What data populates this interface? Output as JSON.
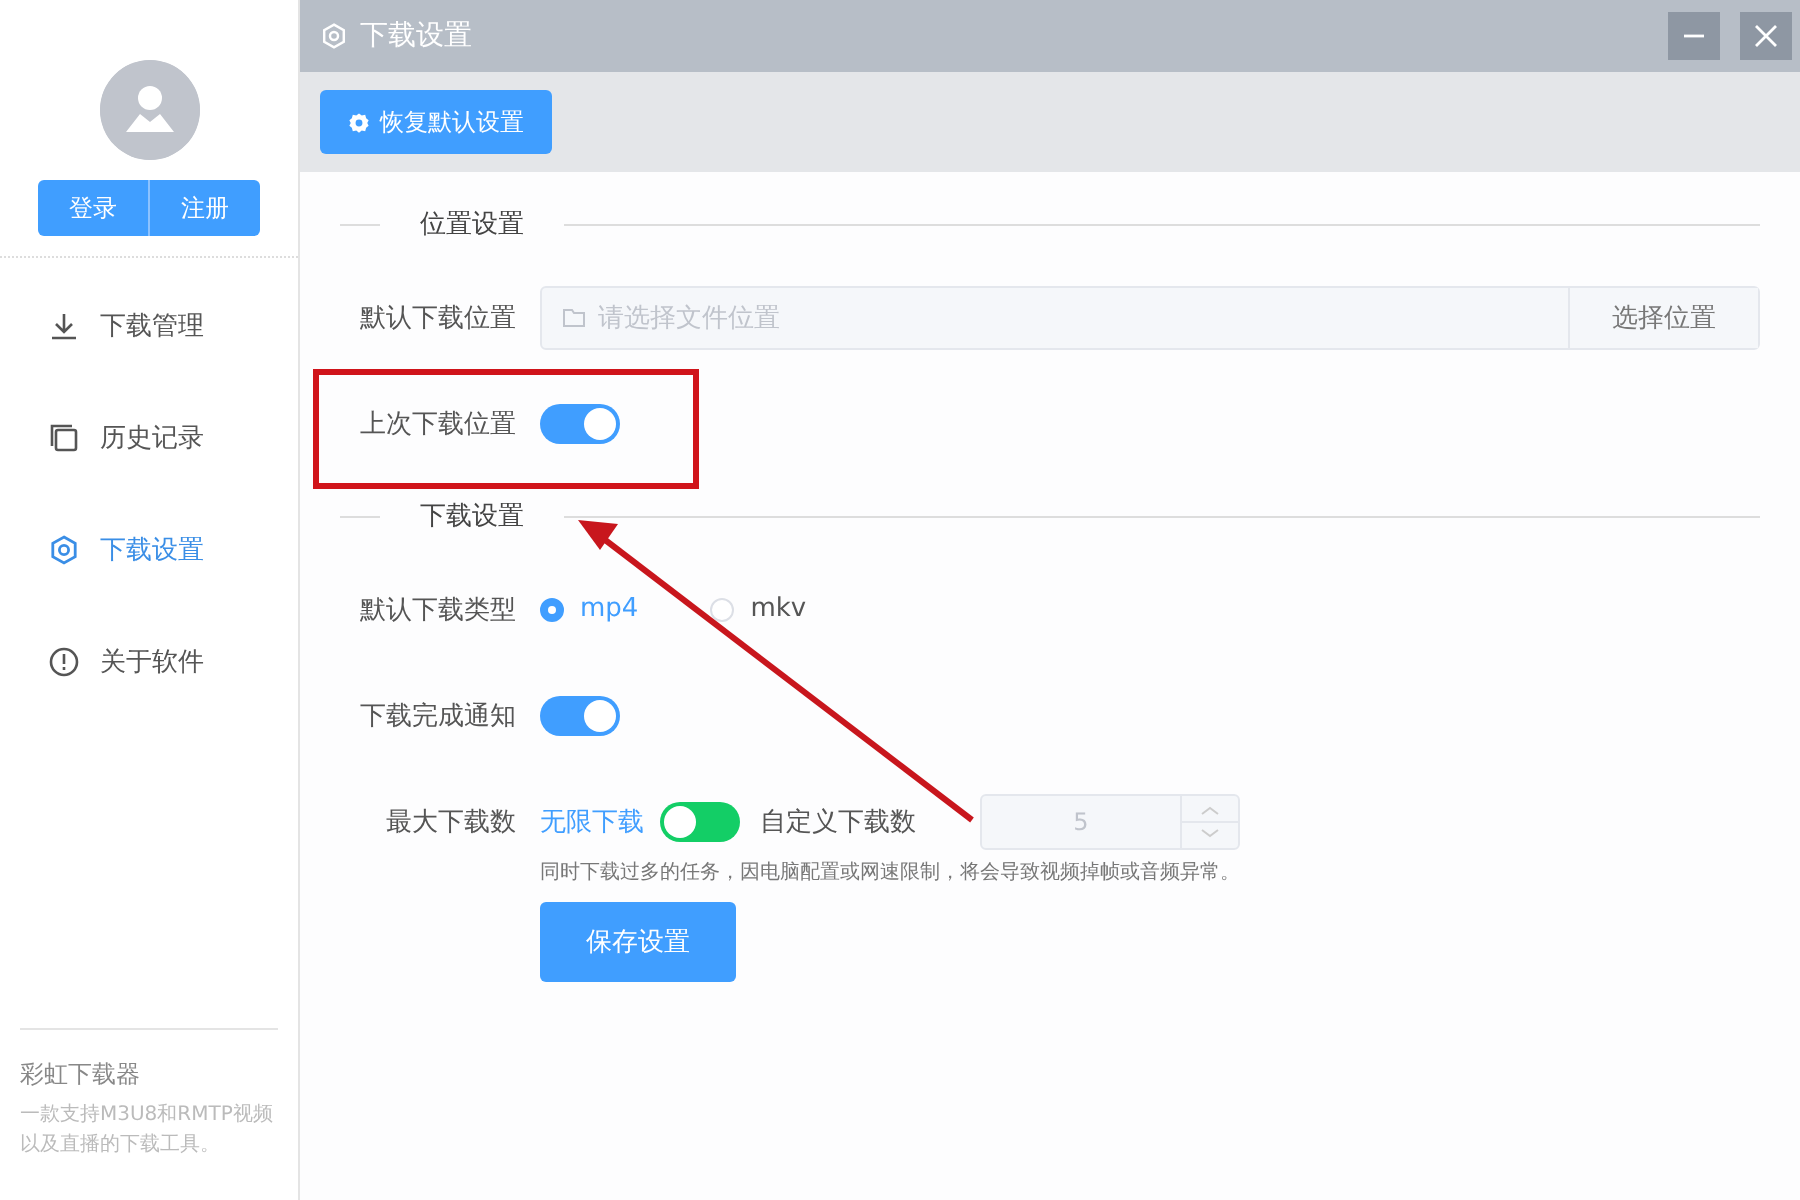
{
  "sidebar": {
    "login_button": "登录",
    "register_button": "注册",
    "items": [
      {
        "kind": "download",
        "label": "下载管理",
        "selected": false
      },
      {
        "kind": "history",
        "label": "历史记录",
        "selected": false
      },
      {
        "kind": "settings",
        "label": "下载设置",
        "selected": true
      },
      {
        "kind": "about",
        "label": "关于软件",
        "selected": false
      }
    ],
    "app_name": "彩虹下载器",
    "app_description": "一款支持M3U8和RMTP视频以及直播的下载工具。"
  },
  "window": {
    "title": "下载设置"
  },
  "toolbar": {
    "reset_button": "恢复默认设置"
  },
  "sections": [
    {
      "title": "位置设置",
      "rows": [
        {
          "kind": "path",
          "label": "默认下载位置",
          "placeholder": "请选择文件位置",
          "button": "选择位置"
        },
        {
          "kind": "toggle",
          "label": "上次下载位置",
          "on": true
        }
      ]
    },
    {
      "title": "下载设置",
      "rows": [
        {
          "kind": "radio",
          "label": "默认下载类型",
          "options": [
            {
              "label": "mp4",
              "selected": true
            },
            {
              "label": "mkv",
              "selected": false
            }
          ]
        },
        {
          "kind": "toggle",
          "label": "下载完成通知",
          "on": true
        },
        {
          "kind": "limit",
          "label": "最大下载数",
          "left_label": "无限下载",
          "right_label": "自定义下载数",
          "unlimited": true,
          "count": "5",
          "count_disabled": true,
          "hint": "同时下载过多的任务，因电脑配置或网速限制，将会导致视频掉帧或音频异常。"
        }
      ]
    }
  ],
  "save_button": "保存设置",
  "annotation": {
    "highlight": true,
    "arrow": true
  }
}
